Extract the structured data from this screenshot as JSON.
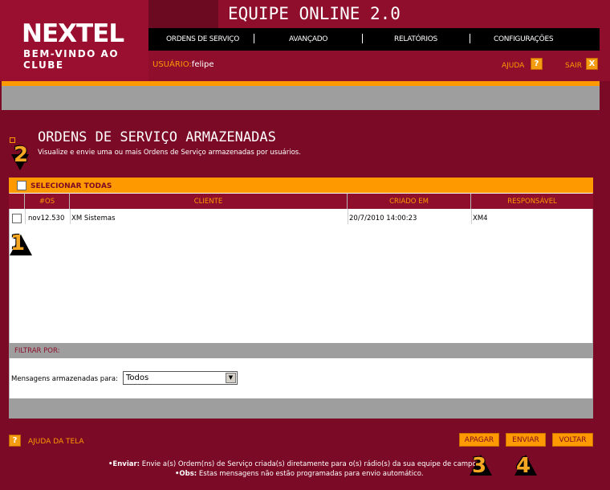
{
  "brand": {
    "logo": "NEXTEL",
    "tagline": "BEM-VINDO AO CLUBE"
  },
  "app_title": "EQUIPE ONLINE 2.0",
  "nav": [
    {
      "label": "ORDENS DE SERVIÇO"
    },
    {
      "label": "AVANÇADO"
    },
    {
      "label": "RELATÓRIOS"
    },
    {
      "label": "CONFIGURAÇÕES"
    }
  ],
  "user": {
    "label": "USUÁRIO:",
    "name": "felipe"
  },
  "top_actions": {
    "help": "AJUDA",
    "help_icon": "?",
    "exit": "SAIR",
    "exit_icon": "X"
  },
  "page": {
    "title": "ORDENS DE SERVIÇO ARMAZENADAS",
    "subtitle": "Visualize e envie uma ou mais Ordens de Serviço armazenadas por usuários."
  },
  "select_all": "SELECIONAR TODAS",
  "table": {
    "columns": [
      "#OS",
      "CLIENTE",
      "CRIADO EM",
      "RESPONSÁVEL"
    ],
    "rows": [
      {
        "os": "nov12.530",
        "client": "XM Sistemas",
        "created": "20/7/2010 14:00:23",
        "owner": "XM4"
      }
    ]
  },
  "filter": {
    "header": "FILTRAR POR:",
    "label": "Mensagens armazenadas para:",
    "value": "Todos"
  },
  "footer": {
    "help_icon": "?",
    "help": "AJUDA DA TELA",
    "buttons": {
      "delete": "APAGAR",
      "send": "ENVIAR",
      "back": "VOLTAR"
    },
    "note1_key": "•Enviar:",
    "note1": " Envie a(s) Ordem(ns) de Serviço criada(s) diretamente para o(s) rádio(s) da sua equipe de campo",
    "note2_key": "•Obs:",
    "note2": " Estas mensagens não estão programadas para envio automático."
  },
  "markers": [
    "1",
    "2",
    "3",
    "4"
  ],
  "colors": {
    "brand": "#8e0e2c",
    "accent": "#ff9900",
    "background": "#7a0a25"
  }
}
